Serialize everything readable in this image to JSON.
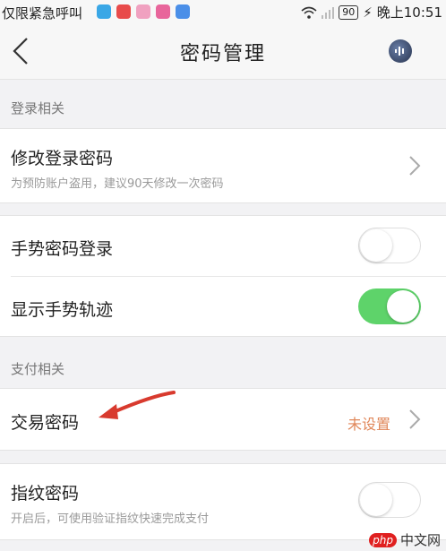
{
  "status_bar": {
    "carrier": "仅限紧急呼叫",
    "battery": "90",
    "time": "晚上10:51"
  },
  "nav": {
    "title": "密码管理",
    "back_icon": "chevron-left-icon",
    "voice_icon": "voice-assistant-icon"
  },
  "sections": {
    "login_header": "登录相关",
    "pay_header": "支付相关"
  },
  "rows": {
    "change_login_password": {
      "title": "修改登录密码",
      "subtitle": "为预防账户盗用，建议90天修改一次密码"
    },
    "gesture_login": {
      "title": "手势密码登录",
      "enabled": false
    },
    "show_gesture_trace": {
      "title": "显示手势轨迹",
      "enabled": true
    },
    "trade_password": {
      "title": "交易密码",
      "value": "未设置"
    },
    "fingerprint_password": {
      "title": "指纹密码",
      "subtitle": "开启后，可使用验证指纹快速完成支付",
      "enabled": false
    }
  },
  "colors": {
    "toggle_on": "#5ed36a",
    "value_text": "#e0875a",
    "annotation_arrow": "#d83a2e"
  },
  "watermark": {
    "logo": "php",
    "text": "中文网"
  }
}
